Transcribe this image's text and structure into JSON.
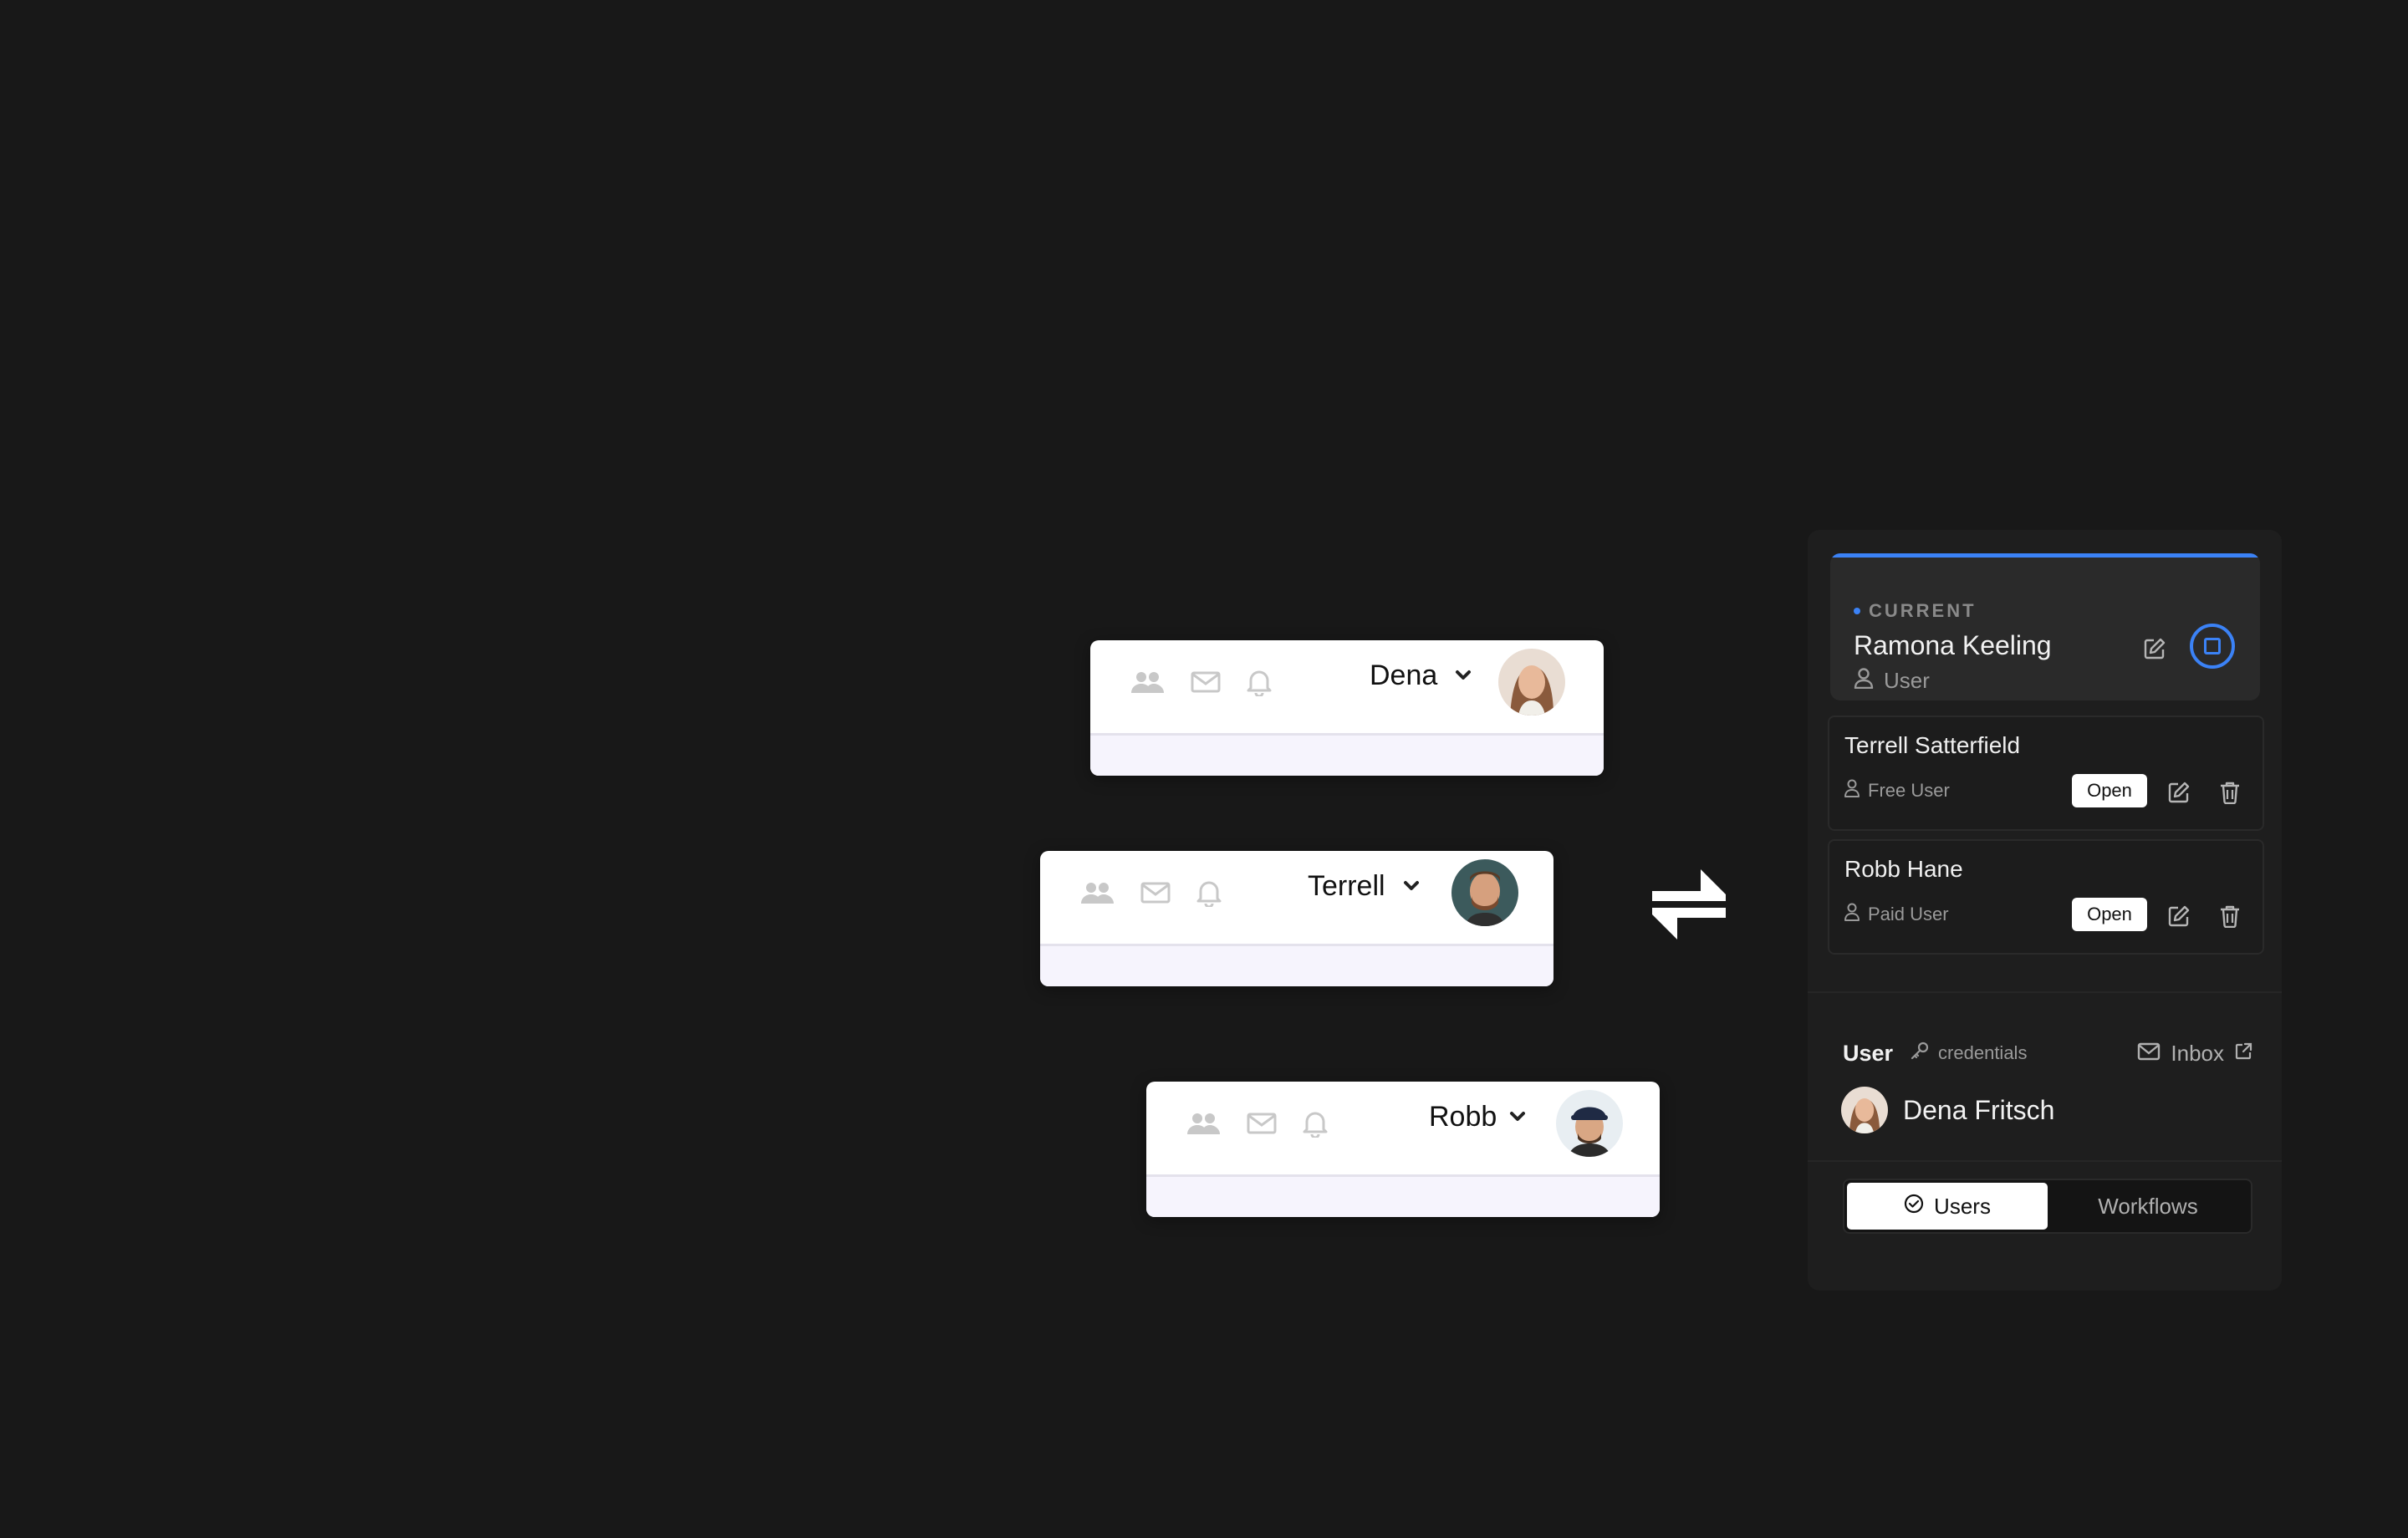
{
  "cards": [
    {
      "name": "Dena"
    },
    {
      "name": "Terrell"
    },
    {
      "name": "Robb"
    }
  ],
  "panel": {
    "current": {
      "label": "CURRENT",
      "name": "Ramona Keeling",
      "role": "User",
      "accent": "#3b82f6"
    },
    "users": [
      {
        "name": "Terrell Satterfield",
        "role": "Free User",
        "open_label": "Open"
      },
      {
        "name": "Robb Hane",
        "role": "Paid User",
        "open_label": "Open"
      }
    ],
    "user_section": {
      "title": "User",
      "credentials": "credentials",
      "inbox": "Inbox",
      "selected_name": "Dena Fritsch"
    },
    "tabs": [
      {
        "label": "Users",
        "active": true
      },
      {
        "label": "Workflows",
        "active": false
      }
    ]
  }
}
